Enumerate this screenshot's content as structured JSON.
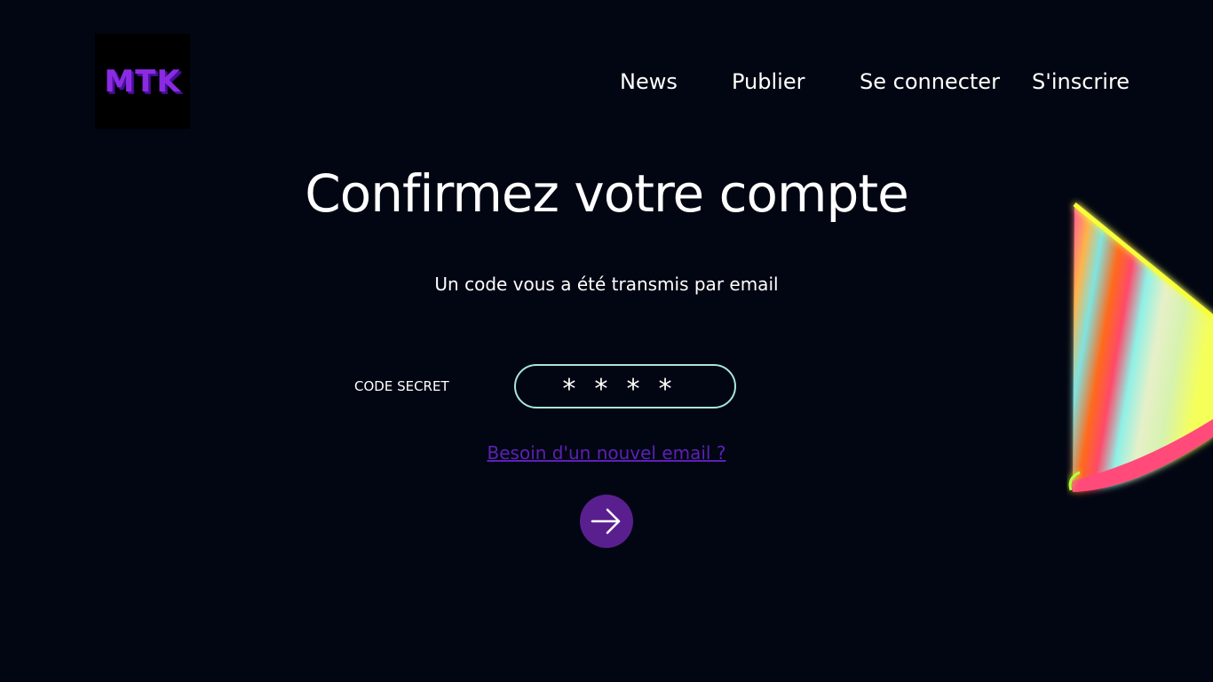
{
  "header": {
    "logo_text": "MTK",
    "nav": {
      "news": "News",
      "publish": "Publier",
      "login": "Se connecter",
      "signup": "S'inscrire"
    }
  },
  "main": {
    "title": "Confirmez votre compte",
    "subtitle": "Un code vous a été transmis par email",
    "code_label": "CODE SECRET",
    "code_value": "****",
    "resend_link": "Besoin d'un nouvel email ?"
  },
  "icons": {
    "submit": "arrow-right-icon",
    "decoration": "party-hat-illustration"
  },
  "colors": {
    "background": "#020612",
    "logo": "#8a2be2",
    "input_border": "#a8e6da",
    "link": "#5b21b6",
    "button": "#5a1f8f"
  }
}
